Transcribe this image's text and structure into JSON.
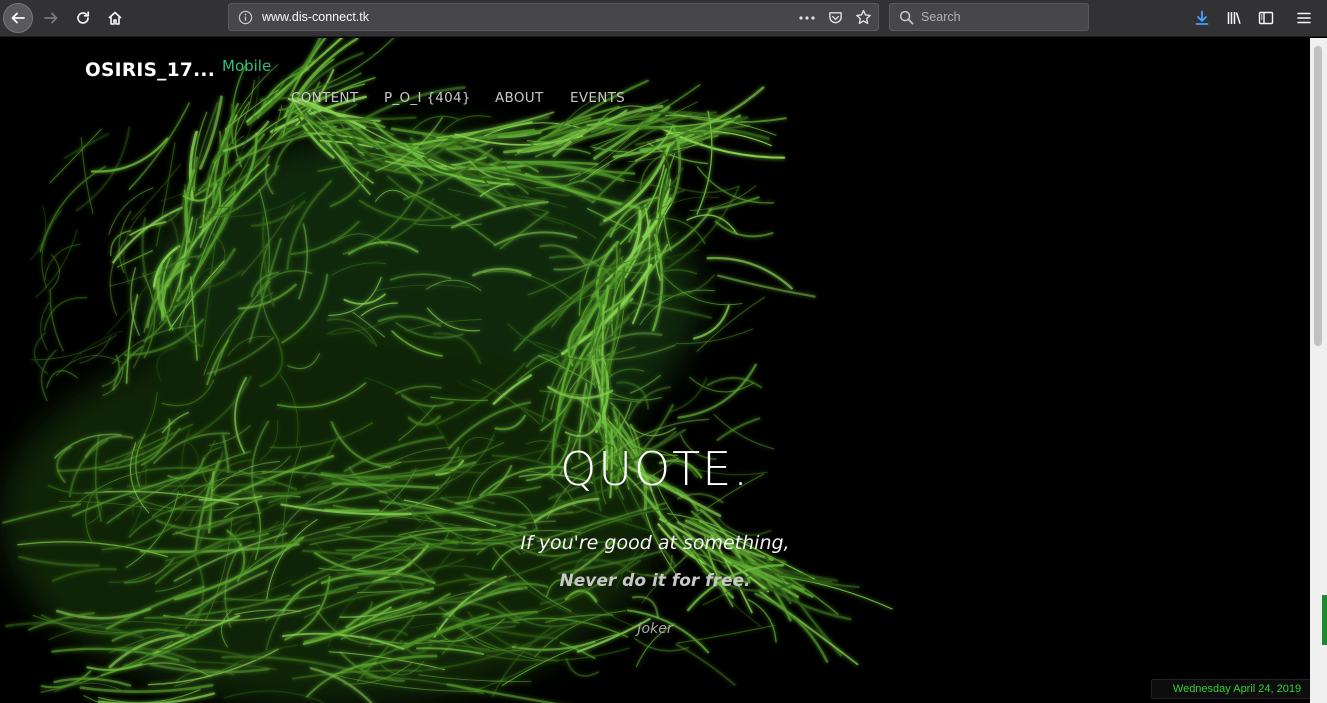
{
  "browser": {
    "url_host": "www.dis-connect.tk",
    "search_placeholder": "Search"
  },
  "site": {
    "brand": "OSIRIS_17...",
    "brand_sub": "Mobile",
    "nav": [
      "CONTENT",
      "P_O_I {404}",
      "ABOUT",
      "EVENTS"
    ]
  },
  "quote": {
    "title": "QUOTE.",
    "line1": "If you're good at something,",
    "line2": "Never do it for free.",
    "author": "Joker"
  },
  "date_badge": "Wednesday April 24, 2019",
  "colors": {
    "accent_green": "#2fbf80",
    "date_green": "#33d033",
    "wolf_glow": "#5ea832"
  }
}
